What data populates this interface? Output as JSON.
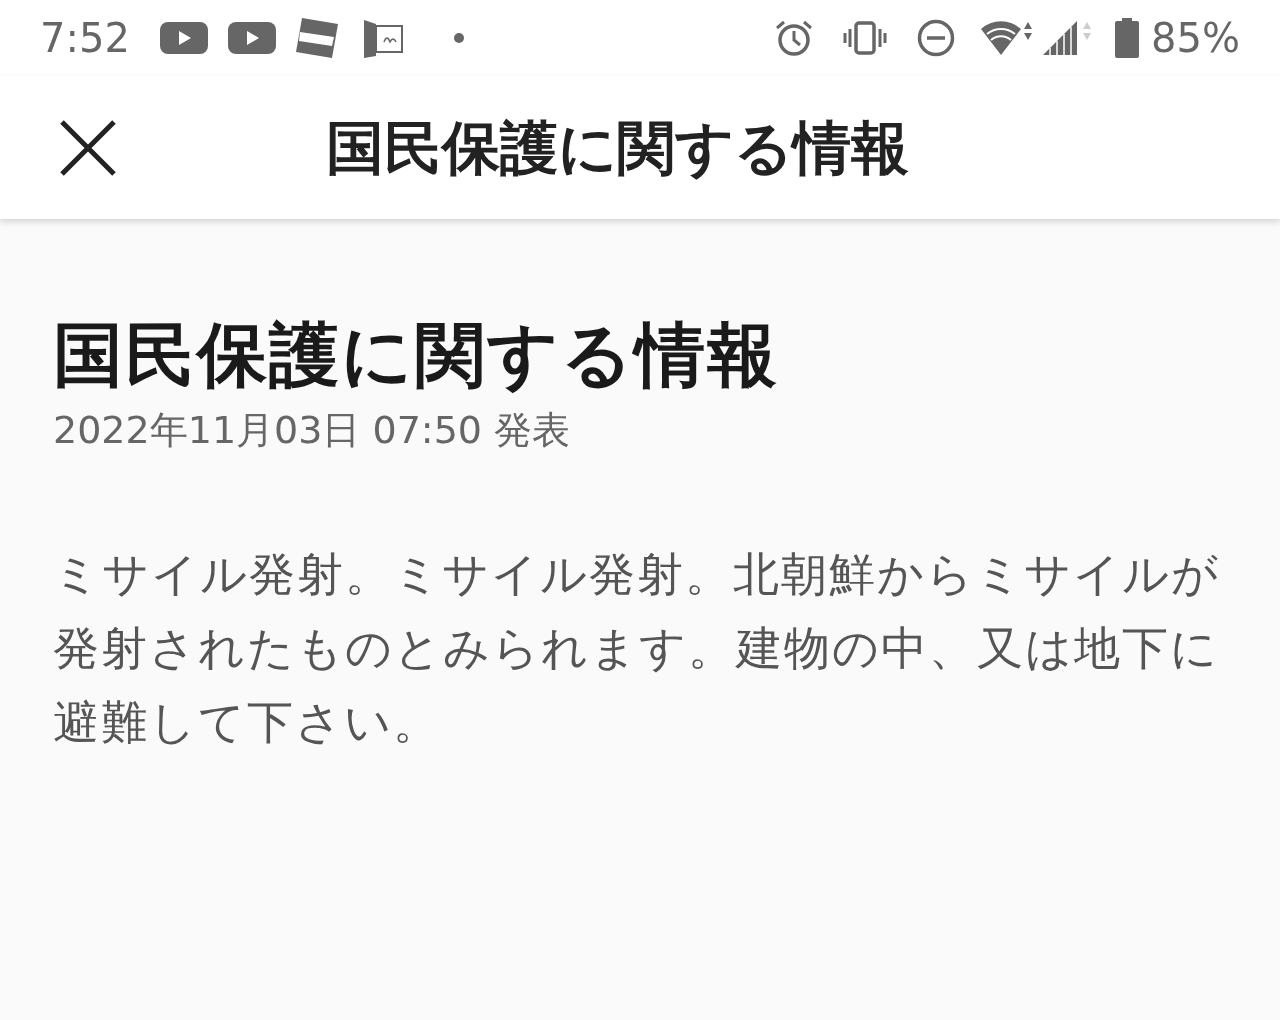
{
  "status_bar": {
    "time": "7:52",
    "battery_percent": "85%"
  },
  "header": {
    "title": "国民保護に関する情報"
  },
  "article": {
    "title": "国民保護に関する情報",
    "published": "2022年11月03日 07:50 発表",
    "body": "ミサイル発射。ミサイル発射。北朝鮮からミサイルが発射されたものとみられます。建物の中、又は地下に避難して下さい。"
  }
}
